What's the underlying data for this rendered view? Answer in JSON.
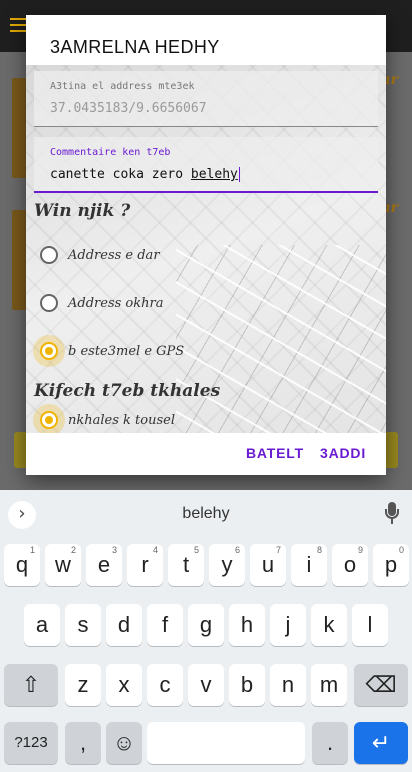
{
  "dialog": {
    "title": "3AMRELNA HEDHY",
    "address_field": {
      "label": "A3tina el address mte3ek",
      "value": "37.0435183/9.6656067"
    },
    "comment_field": {
      "label": "Commentaire ken t7eb",
      "value_prefix": "canette coka zero ",
      "value_current_word": "belehy"
    },
    "where_heading": "Win njik ?",
    "where_options": [
      {
        "label": "Address e dar",
        "checked": false
      },
      {
        "label": "Address okhra",
        "checked": false
      },
      {
        "label": "b este3mel e GPS",
        "checked": true
      }
    ],
    "payment_heading": "Kifech t7eb tkhales",
    "payment_options": [
      {
        "label": "nkhales k tousel",
        "checked": true
      }
    ],
    "cancel_label": "BATELT",
    "confirm_label": "3ADDI"
  },
  "keyboard": {
    "suggestion": "belehy",
    "row1": [
      {
        "k": "q",
        "hint": "1"
      },
      {
        "k": "w",
        "hint": "2"
      },
      {
        "k": "e",
        "hint": "3"
      },
      {
        "k": "r",
        "hint": "4"
      },
      {
        "k": "t",
        "hint": "5"
      },
      {
        "k": "y",
        "hint": "6"
      },
      {
        "k": "u",
        "hint": "7"
      },
      {
        "k": "i",
        "hint": "8"
      },
      {
        "k": "o",
        "hint": "9"
      },
      {
        "k": "p",
        "hint": "0"
      }
    ],
    "row2": [
      "a",
      "s",
      "d",
      "f",
      "g",
      "h",
      "j",
      "k",
      "l"
    ],
    "row3": [
      "z",
      "x",
      "c",
      "v",
      "b",
      "n",
      "m"
    ],
    "symbols_label": "?123",
    "comma_label": ",",
    "period_label": ".",
    "shift_icon": "shift-icon",
    "backspace_icon": "backspace-icon",
    "emoji_icon": "emoji-icon",
    "enter_icon": "enter-icon",
    "enter_color": "#1a73e8"
  },
  "colors": {
    "accent": "#6a1bd1",
    "radio_checked": "#f0b400"
  }
}
